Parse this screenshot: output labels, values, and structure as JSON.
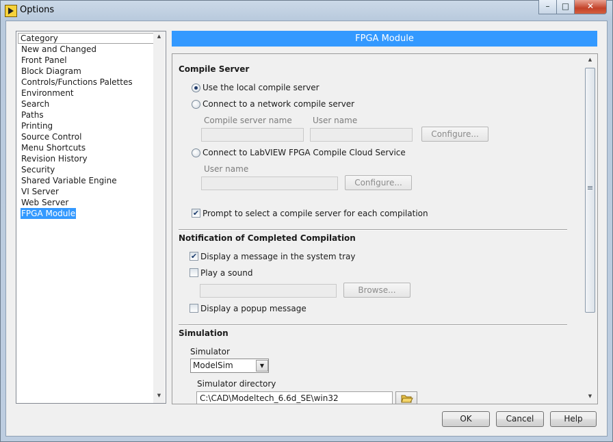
{
  "window": {
    "title": "Options",
    "minimize": "–",
    "maximize": "□",
    "close": "✕"
  },
  "sidebar": {
    "header": "Category",
    "items": [
      "New and Changed",
      "Front Panel",
      "Block Diagram",
      "Controls/Functions Palettes",
      "Environment",
      "Search",
      "Paths",
      "Printing",
      "Source Control",
      "Menu Shortcuts",
      "Revision History",
      "Security",
      "Shared Variable Engine",
      "VI Server",
      "Web Server",
      "FPGA Module"
    ],
    "selected": "FPGA Module"
  },
  "panel": {
    "title": "FPGA Module",
    "compile_server": {
      "heading": "Compile Server",
      "opt_local": "Use the local compile server",
      "opt_network": "Connect to a network compile server",
      "server_name_label": "Compile server name",
      "user_name_label": "User name",
      "configure_label": "Configure...",
      "opt_cloud": "Connect to LabVIEW FPGA Compile Cloud Service",
      "cloud_user_label": "User name",
      "cloud_configure_label": "Configure...",
      "prompt_label": "Prompt to select a compile server for each compilation",
      "prompt_checked": true
    },
    "notification": {
      "heading": "Notification of Completed Compilation",
      "tray_label": "Display a message in the system tray",
      "tray_checked": true,
      "sound_label": "Play a sound",
      "sound_checked": false,
      "browse_label": "Browse...",
      "popup_label": "Display a popup message",
      "popup_checked": false
    },
    "simulation": {
      "heading": "Simulation",
      "simulator_label": "Simulator",
      "simulator_value": "ModelSim",
      "directory_label": "Simulator directory",
      "directory_value": "C:\\CAD\\Modeltech_6.6d_SE\\win32"
    }
  },
  "footer": {
    "ok": "OK",
    "cancel": "Cancel",
    "help": "Help"
  },
  "icons": {
    "app": "labview-icon",
    "dropdown": "chevron-down-icon",
    "folder": "folder-open-icon",
    "scroll_up": "arrow-up-icon",
    "scroll_down": "arrow-down-icon"
  }
}
